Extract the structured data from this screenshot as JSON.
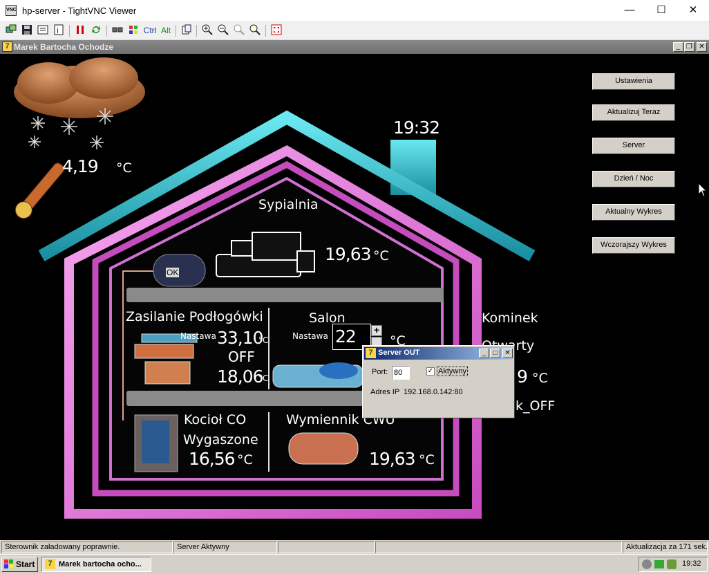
{
  "window": {
    "title": "hp-server - TightVNC Viewer",
    "icon_text": "VNC"
  },
  "toolbar": {
    "items": [
      "new-connection-icon",
      "save-icon",
      "options-icon",
      "info-icon",
      "pause-icon",
      "refresh-icon",
      "ctrl-alt-del-icon",
      "send-ctrl-esc-icon",
      "ctrl-toggle",
      "alt-toggle",
      "clipboard-icon",
      "zoom-in-icon",
      "zoom-out-icon",
      "zoom-100-icon",
      "zoom-auto-icon",
      "fullscreen-icon"
    ],
    "ctrl_label": "Ctrl",
    "alt_label": "Alt"
  },
  "app": {
    "title": "Marek Bartocha Ochodze",
    "clock": "19:32",
    "outside": {
      "temp": "4,19",
      "unit": "°C"
    },
    "bedroom": {
      "label": "Sypialnia",
      "temp": "19,63",
      "unit": "°C"
    },
    "tank_status": "OK",
    "floor_heating": {
      "label": "Zasilanie Podłogówki",
      "setpoint_label": "Nastawa",
      "setpoint": "33,10",
      "unit": "°C",
      "state": "OFF",
      "temp": "18,06",
      "temp_unit": "°C"
    },
    "salon": {
      "label": "Salon",
      "setpoint_label": "Nastawa",
      "setpoint": "22",
      "plus": "+",
      "unit": "°C"
    },
    "fireplace": {
      "label": "Kominek",
      "state": "Otwarty",
      "temp_partial": "9",
      "unit": "°C",
      "status_partial": "k_OFF"
    },
    "boiler": {
      "label": "Kocioł CO",
      "state": "Wygaszone",
      "temp": "16,56",
      "unit": "°C"
    },
    "exchanger": {
      "label": "Wymiennik CWU",
      "temp": "19,63",
      "unit": "°C"
    },
    "buttons": [
      "Ustawienia",
      "Aktualizuj Teraz",
      "Server",
      "Dzień / Noc",
      "Aktualny Wykres",
      "Wczorajszy Wykres"
    ]
  },
  "dialog": {
    "title": "Server OUT",
    "port_label": "Port:",
    "port_value": "80",
    "active_label": "Aktywny",
    "active_checked": true,
    "ip_label": "Adres IP",
    "ip_value": "192.168.0.142:80"
  },
  "statusbar": {
    "cells": [
      "Sterownik załadowany poprawnie.",
      "Server Aktywny",
      "",
      "",
      "Aktualizacja za 171 sek."
    ]
  },
  "taskbar": {
    "start_label": "Start",
    "task_label": "Marek bartocha ocho...",
    "time": "19:32"
  },
  "colors": {
    "house_outer": "#3fd3e0",
    "house_inner": "#e06ad8",
    "dialog_caption": "#0a246a",
    "cloud": "#c8783a"
  }
}
